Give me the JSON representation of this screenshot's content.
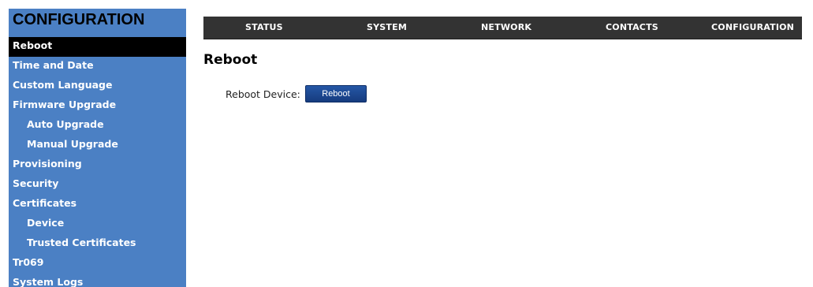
{
  "sidebar": {
    "title": "CONFIGURATION",
    "items": [
      {
        "label": "Reboot"
      },
      {
        "label": "Time and Date"
      },
      {
        "label": "Custom Language"
      },
      {
        "label": "Firmware Upgrade"
      },
      {
        "label": "Auto Upgrade"
      },
      {
        "label": "Manual Upgrade"
      },
      {
        "label": "Provisioning"
      },
      {
        "label": "Security"
      },
      {
        "label": "Certificates"
      },
      {
        "label": "Device"
      },
      {
        "label": "Trusted Certificates"
      },
      {
        "label": "Tr069"
      },
      {
        "label": "System Logs"
      }
    ]
  },
  "topnav": {
    "tabs": [
      {
        "label": "STATUS"
      },
      {
        "label": "SYSTEM"
      },
      {
        "label": "NETWORK"
      },
      {
        "label": "CONTACTS"
      },
      {
        "label": "CONFIGURATION"
      }
    ]
  },
  "main": {
    "title": "Reboot",
    "reboot_label": "Reboot Device:",
    "reboot_button": "Reboot"
  },
  "colors": {
    "sidebar_bg": "#4b80c4",
    "active_item_bg": "#000000",
    "topbar_bg": "#333333",
    "button_bg": "#1f4c99"
  }
}
